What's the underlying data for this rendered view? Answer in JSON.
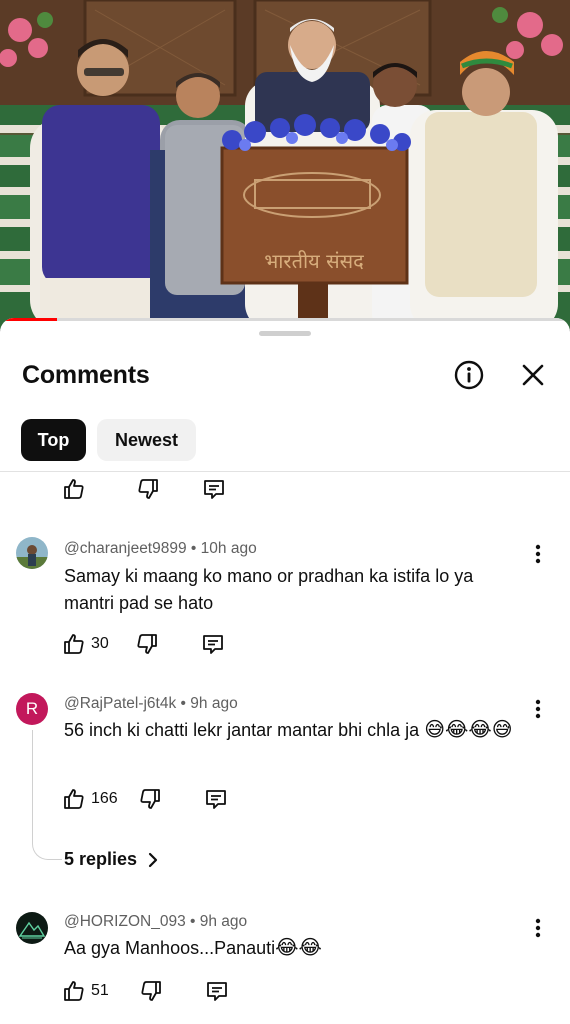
{
  "video": {
    "podium_text": "भारतीय संसद",
    "progress": 0.1
  },
  "header": {
    "title": "Comments",
    "info_icon": "info-icon",
    "close_icon": "close-icon"
  },
  "sort_chips": [
    {
      "label": "Top",
      "selected": true
    },
    {
      "label": "Newest",
      "selected": false
    }
  ],
  "comments": [
    {
      "author": "@charanjeet9899",
      "age": "10h ago",
      "text": "Samay ki maang ko mano or pradhan ka istifa lo ya mantri pad se hato",
      "likes": "30"
    },
    {
      "author": "@RajPatel-j6t4k",
      "age": "9h ago",
      "avatar_letter": "R",
      "avatar_color": "#c2185b",
      "text": "56 inch ki chatti lekr jantar mantar bhi chla ja",
      "emojis": "😅😂😂😅",
      "likes": "166",
      "replies_label": "5 replies"
    },
    {
      "author": "@HORIZON_093",
      "age": "9h ago",
      "text": "Aa gya Manhoos...Panauti",
      "emojis": "😂😂",
      "likes": "51"
    }
  ]
}
